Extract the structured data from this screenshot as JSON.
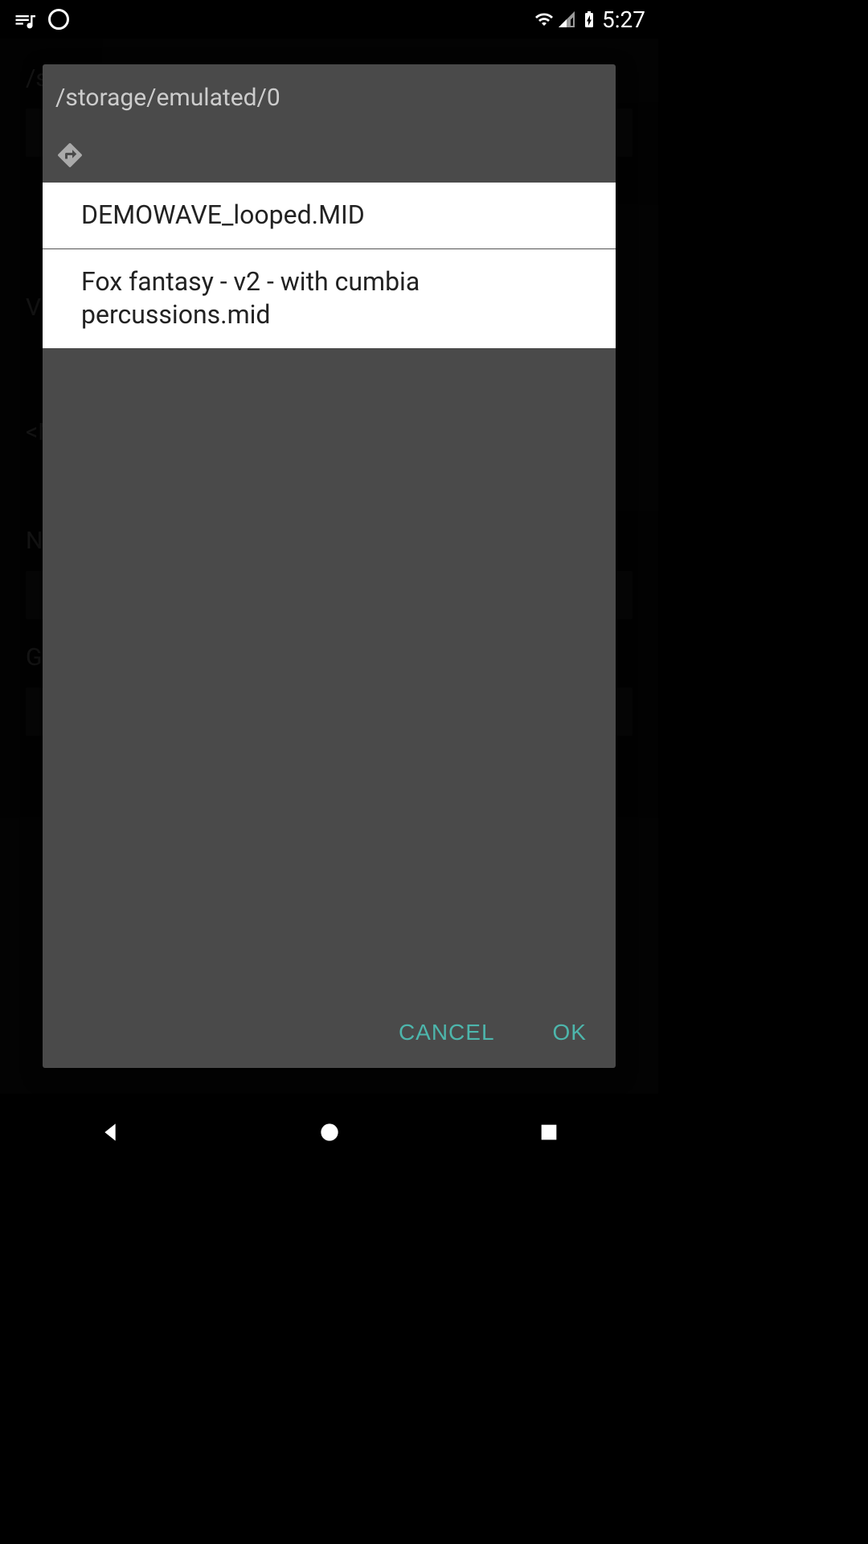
{
  "statusBar": {
    "time": "5:27"
  },
  "background": {
    "pathPrefix": "/s",
    "labelV": "V",
    "labelBracket": "<N",
    "labelN": "N",
    "labelG": "G"
  },
  "dialog": {
    "path": "/storage/emulated/0",
    "files": [
      "DEMOWAVE_looped.MID",
      "Fox fantasy - v2 - with cumbia percussions.mid"
    ],
    "cancelLabel": "CANCEL",
    "okLabel": "OK"
  }
}
